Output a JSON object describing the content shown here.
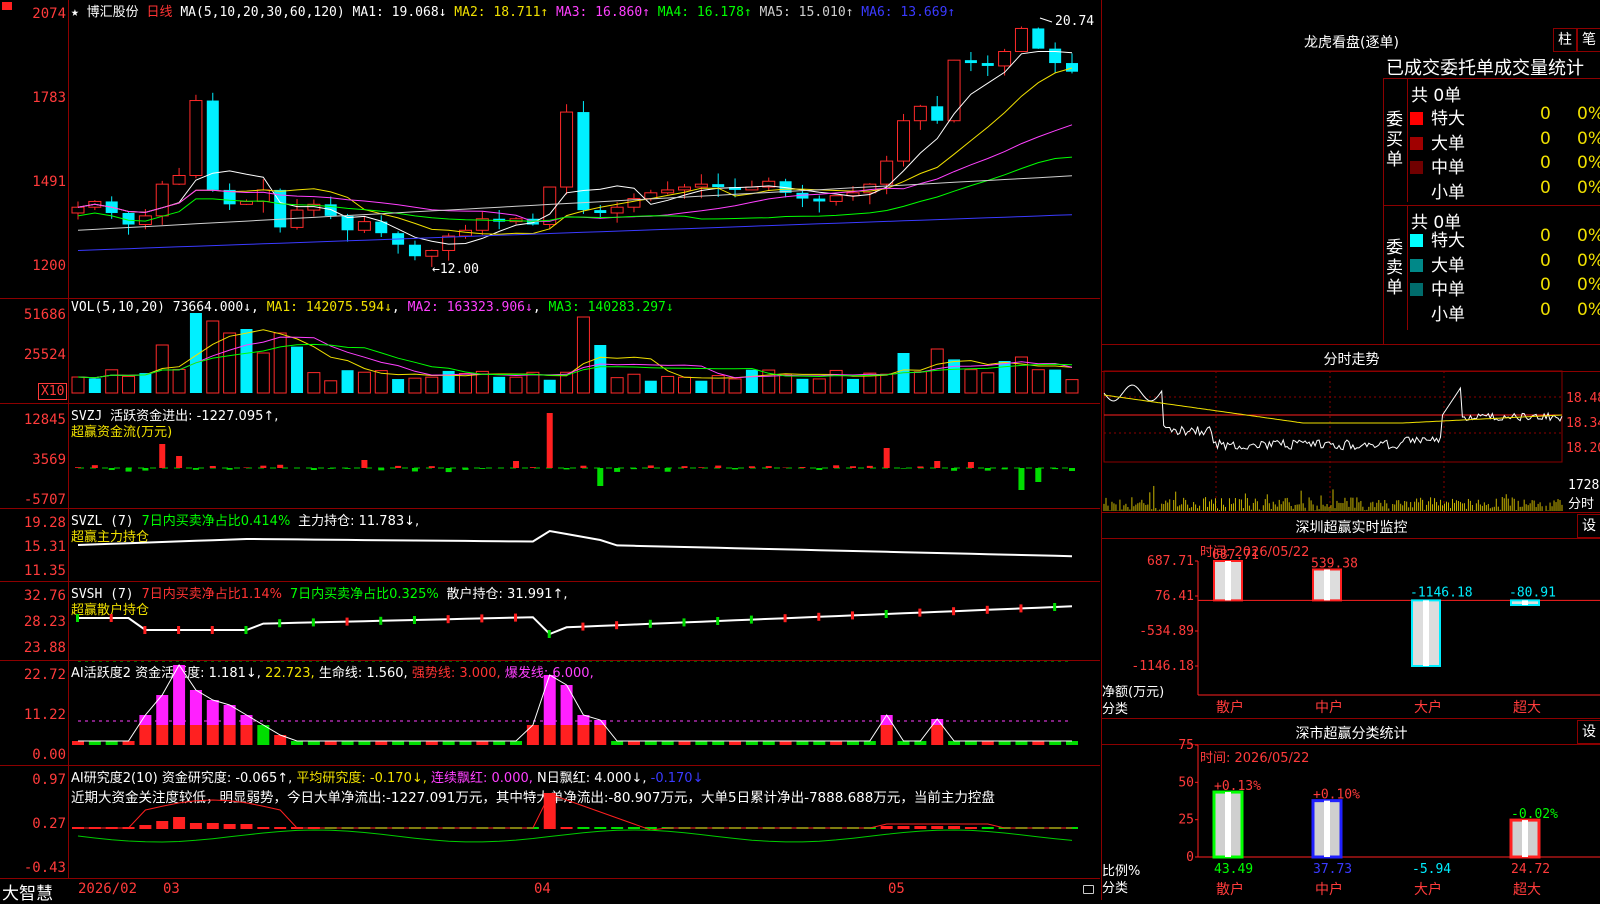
{
  "app": {
    "corner_icon": "red-flag-icon",
    "bottom_brand": "大智慧"
  },
  "stock": {
    "name": "博汇股份",
    "period": "日线",
    "ma_params": "MA(5,10,20,30,60,120)",
    "star": "★"
  },
  "main_chart": {
    "axis": [
      "2074",
      "1783",
      "1491",
      "1200"
    ],
    "ma": [
      {
        "label": "MA1: 19.068↓",
        "color": "#ffffff"
      },
      {
        "label": "MA2: 18.711↑",
        "color": "#f0e000"
      },
      {
        "label": "MA3: 16.860↑",
        "color": "#ff40ff"
      },
      {
        "label": "MA4: 16.178↑",
        "color": "#00ff00"
      },
      {
        "label": "MA5: 15.010↑",
        "color": "#cfcfcf"
      },
      {
        "label": "MA6: 13.669↑",
        "color": "#3a3aff"
      }
    ],
    "high_label": "20.74",
    "low_label": "←12.00"
  },
  "vol_panel": {
    "title": "VOL(5,10,20)",
    "value": "73664.000↓",
    "ma1": "MA1: 142075.594↓",
    "ma2": "MA2: 163323.906↓",
    "ma3": "MA3: 140283.297↓",
    "axis": [
      "51686",
      "25524"
    ],
    "unit": "X10"
  },
  "svzj_panel": {
    "title": "SVZJ",
    "label": "活跃资金进出: -1227.095↑,",
    "sub": "超赢资金流(万元)",
    "axis": [
      "12845",
      "3569",
      "-5707"
    ]
  },
  "svzl_panel": {
    "title": "SVZL (7)",
    "label1": "7日内买卖净占比0.414%",
    "label2": "主力持仓: 11.783↓,",
    "sub": "超赢主力持仓",
    "axis": [
      "19.28",
      "15.31",
      "11.35"
    ]
  },
  "svsh_panel": {
    "title": "SVSH (7)",
    "label1": "7日内买卖净占比1.14%",
    "label2": "7日内买卖净占比0.325%",
    "label3": "散户持仓: 31.991↑,",
    "sub": "超赢散户持仓",
    "axis": [
      "32.76",
      "28.23",
      "23.88"
    ]
  },
  "ai_active_panel": {
    "title": "AI活跃度2",
    "l1": "资金活跃度: 1.181↓,",
    "l2": "22.723,",
    "l3": "生命线: 1.560,",
    "l4": "强势线: 3.000,",
    "l5": "爆发线: 6.000,",
    "axis": [
      "22.72",
      "11.22",
      "0.00"
    ]
  },
  "ai_research_panel": {
    "title": "AI研究度2(10)",
    "l1": "资金研究度: -0.065↑,",
    "l2": "平均研究度: -0.170↓,",
    "l3": "连续飘红: 0.000,",
    "l4": "N日飘红: 4.000↓,",
    "l5": "-0.170↓",
    "comment": "近期大资金关注度较低，明显弱势，今日大单净流出:-1227.091万元，其中特大单净流出:-80.907万元，大单5日累计净出-7888.688万元，当前主力控盘",
    "axis": [
      "0.97",
      "0.27",
      "-0.43"
    ]
  },
  "date_axis": [
    "2026/02",
    "03",
    "04",
    "05"
  ],
  "dragon_tiger": {
    "title": "龙虎看盘(逐单)",
    "btn1": "柱",
    "btn2": "笔",
    "tabs": "已成交委托单成交量统计",
    "buy_label": "委买单",
    "sell_label": "委卖单",
    "buy_total": "共 0单",
    "sell_total": "共 0单",
    "buy_rows": [
      {
        "name": "特大",
        "count": "0",
        "pct": "0%",
        "color": "#ff0000"
      },
      {
        "name": "大单",
        "count": "0",
        "pct": "0%",
        "color": "#a00000"
      },
      {
        "name": "中单",
        "count": "0",
        "pct": "0%",
        "color": "#700000"
      },
      {
        "name": "小单",
        "count": "0",
        "pct": "0%",
        "color": "#000000"
      }
    ],
    "sell_rows": [
      {
        "name": "特大",
        "count": "0",
        "pct": "0%",
        "color": "#00ffff"
      },
      {
        "name": "大单",
        "count": "0",
        "pct": "0%",
        "color": "#008888"
      },
      {
        "name": "中单",
        "count": "0",
        "pct": "0%",
        "color": "#006c6c"
      },
      {
        "name": "小单",
        "count": "0",
        "pct": "0%",
        "color": "#000000"
      }
    ]
  },
  "minute_trend": {
    "title": "分时走势",
    "price_axis": [
      "18.48",
      "18.34",
      "18.20"
    ],
    "vol_axis": [
      "1728",
      "分时"
    ]
  },
  "sz_monitor": {
    "title": "深圳超赢实时监控",
    "settings": "设",
    "time": "时间: 2026/05/22",
    "axis": [
      "687.71",
      "76.41",
      "-534.89",
      "-1146.18"
    ],
    "ylabel": "净额(万元)",
    "xlabel": "分类",
    "bars": [
      {
        "name": "散户",
        "value": 687.71,
        "label": "687.71"
      },
      {
        "name": "中户",
        "value": 539.38,
        "label": "539.38"
      },
      {
        "name": "大户",
        "value": -1146.18,
        "label": "-1146.18"
      },
      {
        "name": "超大",
        "value": -80.91,
        "label": "-80.91"
      }
    ]
  },
  "sz_class": {
    "title": "深市超赢分类统计",
    "settings": "设",
    "time": "时间: 2026/05/22",
    "axis": [
      "75",
      "50",
      "25",
      "0"
    ],
    "ylabel": "比例%",
    "xlabel": "分类",
    "bars": [
      {
        "name": "散户",
        "value": 43.49,
        "label": "43.49",
        "delta": "+0.13%"
      },
      {
        "name": "中户",
        "value": 37.73,
        "label": "37.73",
        "delta": "+0.10%"
      },
      {
        "name": "大户",
        "value": -5.94,
        "label": "-5.94",
        "delta": ""
      },
      {
        "name": "超大",
        "value": 24.72,
        "label": "24.72",
        "delta": "-0.02%"
      }
    ]
  }
}
